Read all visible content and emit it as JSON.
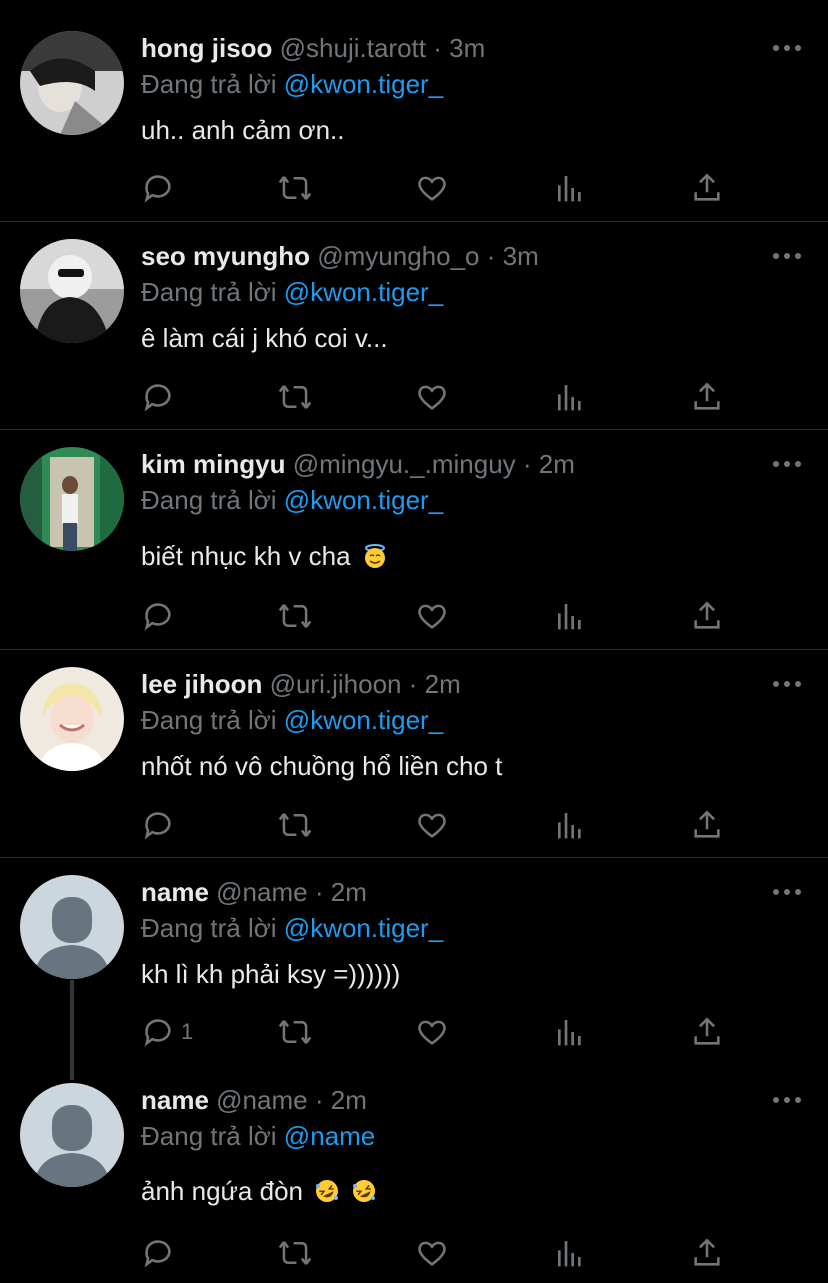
{
  "colors": {
    "background": "#000000",
    "text": "#e7e9ea",
    "muted": "#71767b",
    "accent": "#1d9bf0",
    "divider": "#2f3336"
  },
  "reply_prefix": "Đang trả lời",
  "separator": "·",
  "actions": [
    "reply-icon",
    "retweet-icon",
    "like-icon",
    "views-icon",
    "share-icon"
  ],
  "tweets": [
    {
      "name": "hong jisoo",
      "handle": "@shuji.tarott",
      "time": "3m",
      "mention": "@kwon.tiger_",
      "text": "uh.. anh cảm ơn..",
      "reply_count": ""
    },
    {
      "name": "seo myungho",
      "handle": "@myungho_o",
      "time": "3m",
      "mention": "@kwon.tiger_",
      "text": "ê làm cái j khó coi v...",
      "reply_count": ""
    },
    {
      "name": "kim mingyu",
      "handle": "@mingyu._.minguy",
      "time": "2m",
      "mention": "@kwon.tiger_",
      "text": "biết nhục kh v cha",
      "reply_count": ""
    },
    {
      "name": "lee jihoon",
      "handle": "@uri.jihoon",
      "time": "2m",
      "mention": "@kwon.tiger_",
      "text": "nhốt nó vô chuồng hổ liền cho t",
      "reply_count": ""
    },
    {
      "name": "name",
      "handle": "@name",
      "time": "2m",
      "mention": "@kwon.tiger_",
      "text": "kh lì kh phải ksy =))))))",
      "reply_count": "1"
    },
    {
      "name": "name",
      "handle": "@name",
      "time": "2m",
      "mention": "@name",
      "text": "ảnh ngứa đòn",
      "reply_count": ""
    }
  ]
}
